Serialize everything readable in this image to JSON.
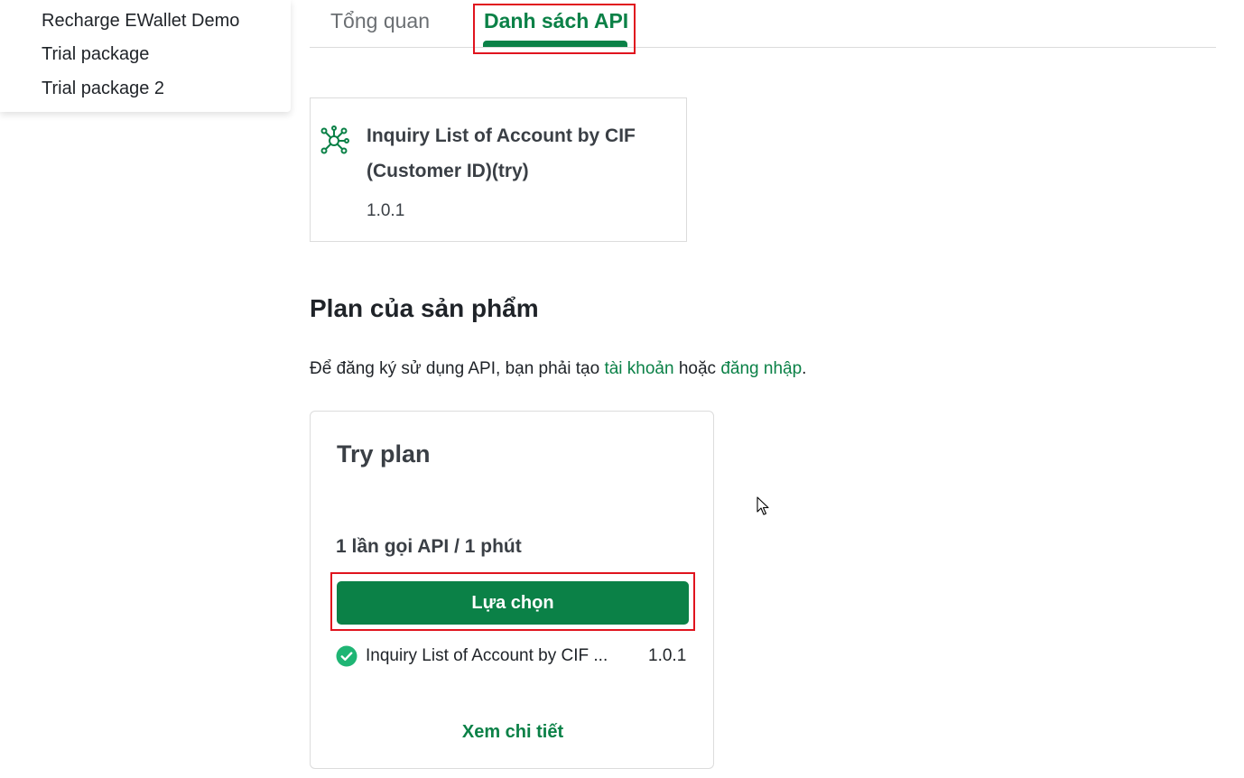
{
  "dropdown": {
    "items": [
      {
        "label": "Recharge EWallet Demo"
      },
      {
        "label": "Trial package"
      },
      {
        "label": "Trial package 2"
      }
    ]
  },
  "tabs": [
    {
      "label": "Tổng quan",
      "active": false
    },
    {
      "label": "Danh sách API",
      "active": true
    }
  ],
  "api_card": {
    "icon": "api-network-icon",
    "name": "Inquiry List of Account by CIF (Customer ID)(try)",
    "version": "1.0.1"
  },
  "plans_section": {
    "title": "Plan của sản phẩm",
    "register_prefix": "Để đăng ký sử dụng API, bạn phải tạo ",
    "create_account_link": "tài khoản",
    "register_middle": " hoặc ",
    "login_link": "đăng nhập",
    "register_suffix": "."
  },
  "plan": {
    "name": "Try plan",
    "rate": "1 lần gọi API / 1 phút",
    "select_label": "Lựa chọn",
    "api": {
      "icon": "check-circle-icon",
      "name": "Inquiry List of Account by CIF ...",
      "version": "1.0.1"
    },
    "detail_link": "Xem chi tiết"
  },
  "colors": {
    "brand_green": "#0b8147",
    "check_green": "#1fb574",
    "highlight_red": "#e0141e"
  }
}
